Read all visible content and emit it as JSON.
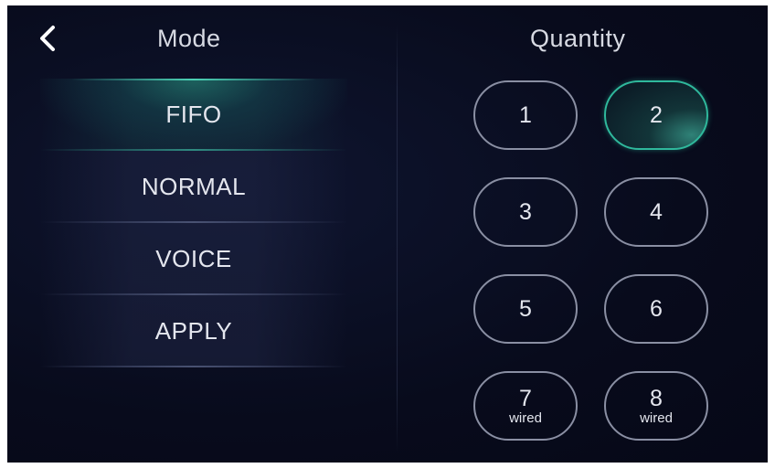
{
  "header": {
    "back_icon": "chevron-left-icon",
    "mode_title": "Mode",
    "quantity_title": "Quantity"
  },
  "mode": {
    "items": [
      {
        "label": "FIFO",
        "selected": true
      },
      {
        "label": "NORMAL",
        "selected": false
      },
      {
        "label": "VOICE",
        "selected": false
      },
      {
        "label": "APPLY",
        "selected": false
      }
    ]
  },
  "quantity": {
    "buttons": [
      {
        "label": "1",
        "sub": "",
        "selected": false
      },
      {
        "label": "2",
        "sub": "",
        "selected": true
      },
      {
        "label": "3",
        "sub": "",
        "selected": false
      },
      {
        "label": "4",
        "sub": "",
        "selected": false
      },
      {
        "label": "5",
        "sub": "",
        "selected": false
      },
      {
        "label": "6",
        "sub": "",
        "selected": false
      },
      {
        "label": "7",
        "sub": "wired",
        "selected": false
      },
      {
        "label": "8",
        "sub": "wired",
        "selected": false
      }
    ]
  },
  "colors": {
    "background": "#080b1c",
    "accent": "#2fb89c",
    "text": "#e4e6ee",
    "button_border": "#8a8fa3"
  }
}
